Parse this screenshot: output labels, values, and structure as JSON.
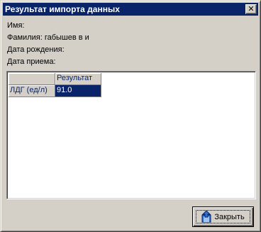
{
  "window": {
    "title": "Результат импорта данных",
    "close_glyph": "✕"
  },
  "info": {
    "name_label": "Имя:",
    "surname_label": "Фамилия: габышев в и",
    "birthdate_label": "Дата рождения:",
    "admission_label": "Дата приема:"
  },
  "grid": {
    "column_header": "Результат",
    "rows": [
      {
        "label": "ЛДГ (ед/л)",
        "value": "91.0"
      }
    ]
  },
  "footer": {
    "close_label": "Закрыть",
    "close_mnemonic": "З",
    "close_icon": "door-exit-icon"
  },
  "colors": {
    "title_bar": "#0a246a",
    "selection": "#0a246a",
    "face": "#d4d0c8",
    "icon_blue": "#2f6fd0"
  }
}
